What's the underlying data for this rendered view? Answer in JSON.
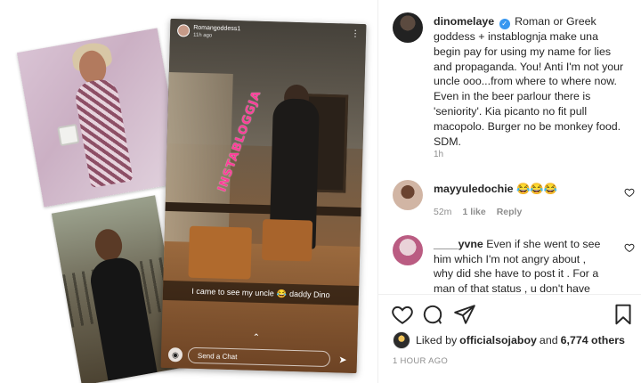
{
  "story": {
    "username": "Romangoddess1",
    "time": "11h ago",
    "watermark": "INSTABLOGGJA",
    "caption_before": "I came to see my uncle",
    "caption_emoji": "😂",
    "caption_after": "daddy Dino",
    "send_chat": "Send a Chat"
  },
  "post": {
    "author": "dinomelaye",
    "caption": "Roman or Greek goddess + instablognja make una begin pay for using my name for lies and propaganda. You! Anti I'm not your uncle ooo...from where to where now. Even in the beer parlour there is 'seniority'. Kia picanto no fit pull macopolo. Burger no be monkey food. SDM.",
    "caption_time": "1h"
  },
  "comments": [
    {
      "username": "mayyuledochie",
      "text": "😂😂😂",
      "time": "52m",
      "likes": "1 like",
      "reply": "Reply"
    },
    {
      "username": "____yvne",
      "text": "Even if she went to see him which I'm not angry about , why did she have to post it . For a man of that status , u don't have"
    }
  ],
  "likes": {
    "prefix": "Liked by",
    "user": "officialsojaboy",
    "conj": "and",
    "others": "6,774 others"
  },
  "post_age": "1 HOUR AGO",
  "colors": {
    "verified": "#3897f0",
    "muted": "#8e8e8e",
    "text": "#262626",
    "watermark": "#ff3e9a"
  },
  "icons": [
    "verified-badge-icon",
    "heart-icon",
    "comment-icon",
    "share-icon",
    "bookmark-icon",
    "camera-icon",
    "send-arrow-icon",
    "more-icon"
  ]
}
